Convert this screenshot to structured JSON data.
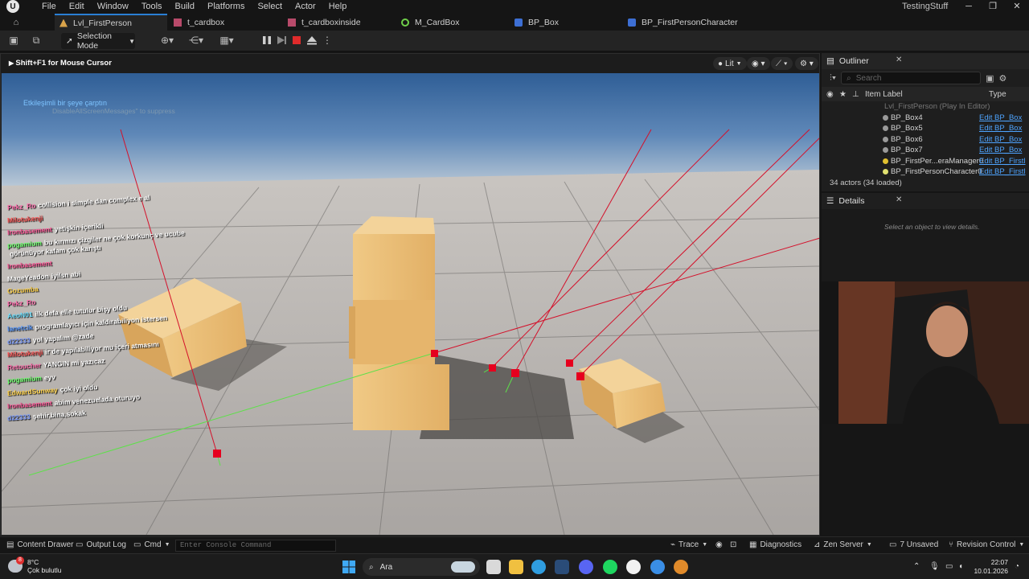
{
  "menubar": {
    "items": [
      "File",
      "Edit",
      "Window",
      "Tools",
      "Build",
      "Platforms",
      "Select",
      "Actor",
      "Help"
    ],
    "project": "TestingStuff"
  },
  "tabs": [
    "Lvl_FirstPerson",
    "t_cardbox",
    "t_cardboxinside",
    "M_CardBox",
    "BP_Box",
    "BP_FirstPersonCharacter"
  ],
  "toolbar": {
    "selection_mode": "Selection Mode"
  },
  "viewport": {
    "mouse_hint": "Shift+F1 for Mouse Cursor",
    "view_mode": "Lit",
    "screen_message_1": "Etkileşimli bir şeye çarptın",
    "screen_message_2": "DisableAllScreenMessages\" to suppress"
  },
  "chat": [
    {
      "user": "Pekz_Ro",
      "text": "collision i simple dan complex e al",
      "color": "#ff6fae"
    },
    {
      "user": "Milotukenji",
      "text": "",
      "color": "#ff5a5a"
    },
    {
      "user": "Ironbasement",
      "text": "yetişkin içerikli",
      "color": "#ff5a9a"
    },
    {
      "user": "pogamium",
      "text": "bu kırmızı çizgiler ne çok korkunç ve ucube",
      "color": "#6dff6d"
    },
    {
      "user": "",
      "text": "görünüyor kafam çok karıştı",
      "color": "#ffffff"
    },
    {
      "user": "Ironbasement",
      "text": "",
      "color": "#ff5a9a"
    },
    {
      "user": "MageYeadon",
      "text": "iyilsn abi",
      "color": "#ffffff"
    },
    {
      "user": "Gozumba",
      "text": "",
      "color": "#ffd34d"
    },
    {
      "user": "Pekz_Ro",
      "text": "",
      "color": "#ff6fae"
    },
    {
      "user": "AeoN01",
      "text": "ilk defa elle tutulur bişy oldu",
      "color": "#6de0ff"
    },
    {
      "user": "lanetcik",
      "text": "programlayıcı için kaldırabiliyon istersen",
      "color": "#5a9aff"
    },
    {
      "user": "d22333",
      "text": "yol yapalım @zade",
      "color": "#7f9fff"
    },
    {
      "user": "Milotukenji",
      "text": "ir de yapılabiliyor mu içeri atmasını",
      "color": "#ff5a5a"
    },
    {
      "user": "Retoucher",
      "text": "YANGIN mi yazıcaz",
      "color": "#ff6fae"
    },
    {
      "user": "pogamium",
      "text": "eyv",
      "color": "#6dff6d"
    },
    {
      "user": "EdwardSunway",
      "text": "çok iyi oldu",
      "color": "#ffd34d"
    },
    {
      "user": "Ironbasement",
      "text": "abim venezuelada oturuyo",
      "color": "#ff5a9a"
    },
    {
      "user": "d22333",
      "text": "şehir,bina,sokak",
      "color": "#7f9fff"
    }
  ],
  "outliner": {
    "title": "Outliner",
    "search_placeholder": "Search",
    "col_label": "Item Label",
    "col_type": "Type",
    "level_row": "Lvl_FirstPerson (Play In Editor)",
    "rows": [
      {
        "name": "BP_Box4",
        "type": "Edit BP_Box"
      },
      {
        "name": "BP_Box5",
        "type": "Edit BP_Box"
      },
      {
        "name": "BP_Box6",
        "type": "Edit BP_Box"
      },
      {
        "name": "BP_Box7",
        "type": "Edit BP_Box"
      },
      {
        "name": "BP_FirstPer...eraManager0",
        "type": "Edit BP_Firstl"
      },
      {
        "name": "BP_FirstPersonCharacter0",
        "type": "Edit BP_Firstl"
      }
    ],
    "actor_count": "34 actors (34 loaded)"
  },
  "details": {
    "title": "Details",
    "empty_text": "Select an object to view details."
  },
  "statusbar": {
    "content_drawer": "Content Drawer",
    "output_log": "Output Log",
    "cmd": "Cmd",
    "console_placeholder": "Enter Console Command",
    "trace": "Trace",
    "diagnostics": "Diagnostics",
    "zen_server": "Zen Server",
    "unsaved": "7 Unsaved",
    "revision_control": "Revision Control"
  },
  "taskbar": {
    "temperature": "8°C",
    "weather": "Çok bulutlu",
    "weather_badge": "8",
    "search": "Ara",
    "time": "22:07",
    "date": "10.01.2026"
  }
}
